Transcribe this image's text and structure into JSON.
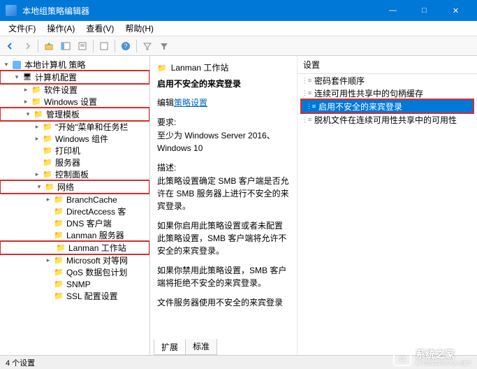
{
  "window": {
    "title": "本地组策略编辑器",
    "min": "—",
    "max": "□",
    "close": "✕"
  },
  "menu": {
    "file": "文件(F)",
    "action": "操作(A)",
    "view": "查看(V)",
    "help": "帮助(H)"
  },
  "tree": {
    "root": "本地计算机 策略",
    "computer_config": "计算机配置",
    "software": "软件设置",
    "windows_settings": "Windows 设置",
    "admin_templates": "管理模板",
    "start_menu": "\"开始\"菜单和任务栏",
    "windows_components": "Windows 组件",
    "printers": "打印机",
    "server": "服务器",
    "control_panel": "控制面板",
    "network": "网络",
    "branchcache": "BranchCache",
    "directaccess": "DirectAccess 客",
    "dns_client": "DNS 客户端",
    "lanman_server": "Lanman 服务器",
    "lanman_workstation": "Lanman 工作站",
    "microsoft_peer": "Microsoft 对等网",
    "qos": "QoS 数据包计划",
    "snmp": "SNMP",
    "ssl": "SSL 配置设置"
  },
  "detail": {
    "crumb": "Lanman 工作站",
    "heading": "启用不安全的来宾登录",
    "edit_label": "编辑",
    "edit_link": "策略设置",
    "requirements_label": "要求:",
    "requirements_text": "至少为 Windows Server 2016、Windows 10",
    "description_label": "描述:",
    "description_p1": "此策略设置确定 SMB 客户端是否允许在 SMB 服务器上进行不安全的来宾登录。",
    "description_p2": "如果你启用此策略设置或者未配置此策略设置，SMB 客户端将允许不安全的来宾登录。",
    "description_p3": "如果你禁用此策略设置，SMB 客户端将拒绝不安全的来宾登录。",
    "description_p4": "文件服务器使用不安全的来宾登录"
  },
  "settings": {
    "header": "设置",
    "items": [
      "密码套件顺序",
      "连续可用性共享中的句柄缓存",
      "启用不安全的来宾登录",
      "脱机文件在连续可用性共享中的可用性"
    ]
  },
  "tabs": {
    "extended": "扩展",
    "standard": "标准"
  },
  "status": "4 个设置",
  "watermark": {
    "brand": "系统之家",
    "url": "XITONGZHIJIA.NET"
  }
}
